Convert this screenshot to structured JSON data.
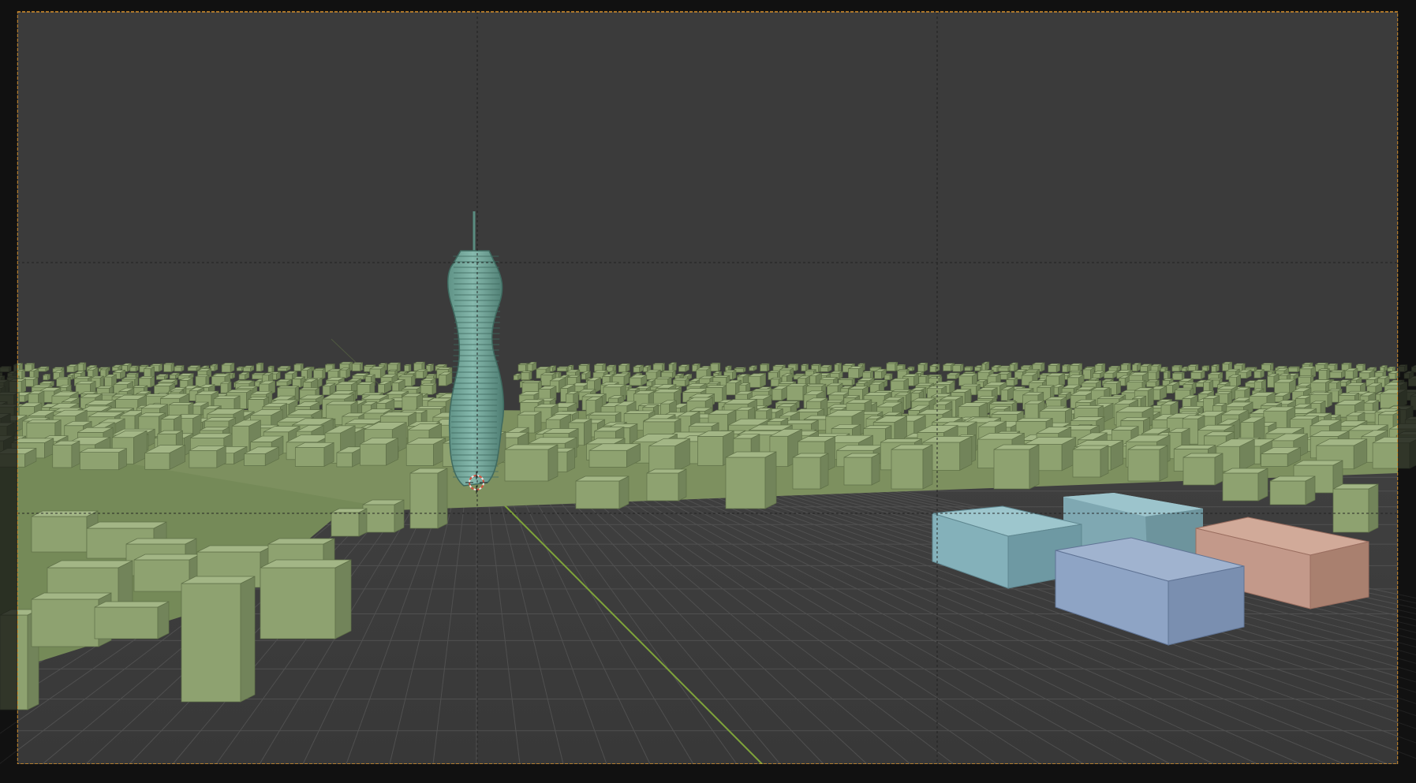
{
  "viewport": {
    "view_mode": "camera-view",
    "shading": "solid",
    "colors": {
      "outside_frame": "#111111",
      "sky": "#3b3b3b",
      "ground": "#3f3f3f",
      "grid": "#4d4d4d",
      "camera_frame": "#d9922c",
      "y_axis": "#7ea33a",
      "city_blocks": "#8ea270",
      "city_base": "#7d905f",
      "tower": "#74a89c",
      "box_teal": "#8db7bf",
      "box_steel": "#8fa5c6",
      "box_salmon": "#c49a8a"
    }
  },
  "scene": {
    "objects": [
      {
        "name": "city-blocks",
        "icon": "mesh-icon"
      },
      {
        "name": "twisted-tower",
        "icon": "mesh-icon"
      },
      {
        "name": "box-teal-1",
        "icon": "cube-icon"
      },
      {
        "name": "box-teal-2",
        "icon": "cube-icon"
      },
      {
        "name": "box-steel",
        "icon": "cube-icon"
      },
      {
        "name": "box-salmon",
        "icon": "cube-icon"
      }
    ],
    "origin_marker": "3d-cursor-icon"
  }
}
